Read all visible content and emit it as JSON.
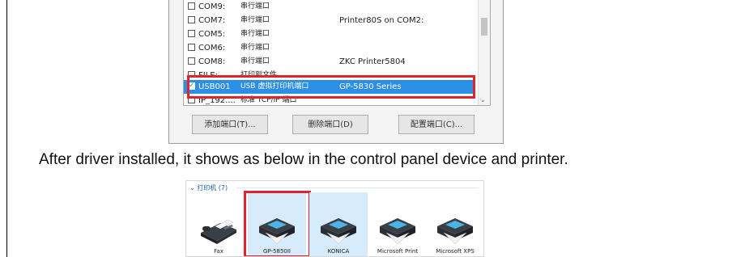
{
  "port_dialog": {
    "rows": [
      {
        "port": "COM9:",
        "desc": "串行端口",
        "printer": "",
        "checked": false,
        "selected": false
      },
      {
        "port": "COM7:",
        "desc": "串行端口",
        "printer": "Printer80S on COM2:",
        "checked": false,
        "selected": false
      },
      {
        "port": "COM5:",
        "desc": "串行端口",
        "printer": "",
        "checked": false,
        "selected": false
      },
      {
        "port": "COM6:",
        "desc": "串行端口",
        "printer": "",
        "checked": false,
        "selected": false
      },
      {
        "port": "COM8:",
        "desc": "串行端口",
        "printer": "ZKC Printer5804",
        "checked": false,
        "selected": false
      },
      {
        "port": "FILE:",
        "desc": "打印到文件",
        "printer": "",
        "checked": false,
        "selected": false
      },
      {
        "port": "USB001",
        "desc": "USB 虚拟打印机端口",
        "printer": "GP-5830 Series",
        "checked": true,
        "selected": true
      },
      {
        "port": "IP_192....",
        "desc": "标准 TCP/IP 端口",
        "printer": "",
        "checked": false,
        "selected": false
      }
    ],
    "buttons": {
      "add": "添加端口(T)...",
      "delete": "删除端口(D)",
      "configure": "配置端口(C)..."
    }
  },
  "caption": "After driver installed, it shows as below in the control panel device and printer.",
  "printers_panel": {
    "group_header": "打印机 (7)",
    "devices": [
      {
        "label": "Fax",
        "icon": "fax-icon"
      },
      {
        "label": "GP-5850II",
        "icon": "printer-icon"
      },
      {
        "label": "KONICA",
        "icon": "printer-icon"
      },
      {
        "label": "Microsoft Print",
        "icon": "printer-icon"
      },
      {
        "label": "Microsoft XPS",
        "icon": "printer-icon"
      }
    ]
  },
  "colors": {
    "highlight_red": "#e0242c",
    "selection_blue": "#2b8fe6",
    "hover_blue": "#d6ebfb"
  }
}
